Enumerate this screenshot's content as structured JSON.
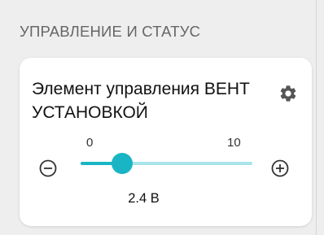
{
  "section": {
    "header": "УПРАВЛЕНИЕ И СТАТУС"
  },
  "card": {
    "title": "Элемент управления ВЕНТ УСТАНОВКОЙ",
    "settings_icon": "gear-icon"
  },
  "slider": {
    "min": "0",
    "max": "10",
    "value": 2.4,
    "value_label": "2.4 В",
    "minus_icon": "minus-circle-icon",
    "plus_icon": "plus-circle-icon"
  },
  "colors": {
    "accent": "#1ab5c4",
    "track": "#a8e3ea",
    "background": "#eeeeee",
    "card": "#ffffff"
  }
}
